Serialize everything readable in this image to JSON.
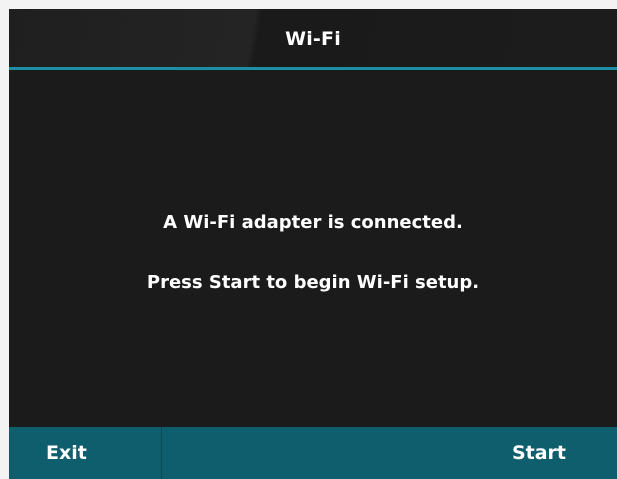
{
  "header": {
    "title": "Wi-Fi"
  },
  "message": {
    "line1": "A Wi-Fi adapter is connected.",
    "line2": "Press Start to begin Wi-Fi setup."
  },
  "softkeys": {
    "left_label": "Exit",
    "right_label": "Start"
  },
  "colors": {
    "accent": "#1e8fa3",
    "softkey_bar": "#0f5e6e",
    "screen_background": "#1b1b1b",
    "text": "#ffffff"
  }
}
